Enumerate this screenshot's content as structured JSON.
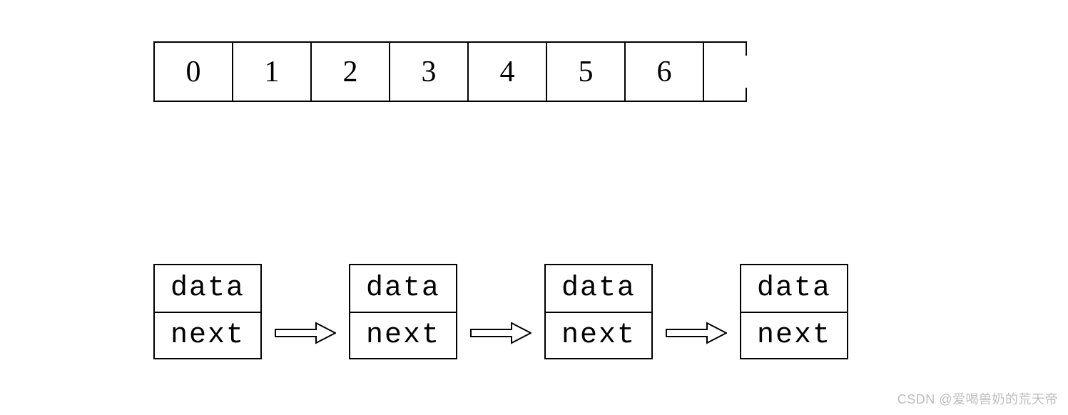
{
  "array": {
    "cells": [
      "0",
      "1",
      "2",
      "3",
      "4",
      "5",
      "6"
    ]
  },
  "linked_list": {
    "nodes": [
      {
        "top": "data",
        "bottom": "next"
      },
      {
        "top": "data",
        "bottom": "next"
      },
      {
        "top": "data",
        "bottom": "next"
      },
      {
        "top": "data",
        "bottom": "next"
      }
    ]
  },
  "watermark": "CSDN @爱喝兽奶的荒天帝"
}
